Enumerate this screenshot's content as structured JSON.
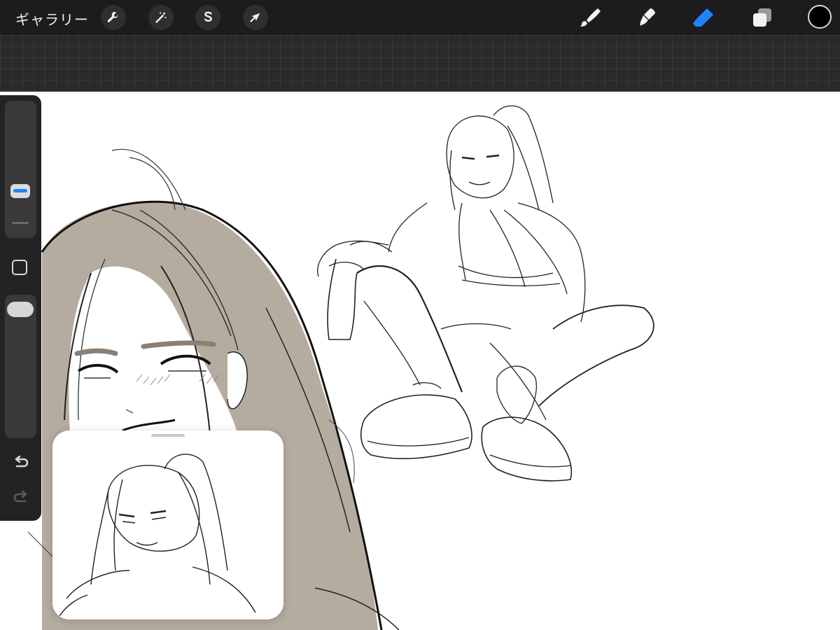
{
  "toolbar": {
    "gallery_label": "ギャラリー",
    "left_tools": [
      {
        "name": "actions",
        "icon": "wrench-icon"
      },
      {
        "name": "adjustments",
        "icon": "magic-wand-icon"
      },
      {
        "name": "selection",
        "icon": "selection-s-icon"
      },
      {
        "name": "transform",
        "icon": "arrow-cursor-icon"
      }
    ],
    "right_tools": [
      {
        "name": "brush",
        "icon": "brush-icon",
        "active": false
      },
      {
        "name": "smudge",
        "icon": "smudge-icon",
        "active": false
      },
      {
        "name": "eraser",
        "icon": "eraser-icon",
        "active": true
      },
      {
        "name": "layers",
        "icon": "layers-icon",
        "active": false
      }
    ],
    "current_color": "#000000"
  },
  "sidebar": {
    "brush_size_icon": "size-slider",
    "opacity_icon": "opacity-slider",
    "modify_icon": "square-icon",
    "undo_icon": "undo-icon",
    "redo_icon": "redo-icon"
  },
  "colors": {
    "accent": "#1e84ff",
    "toolbar_bg": "#1c1c1e",
    "hair_fill": "#b5aca0"
  },
  "reference_window": {
    "icon": "drag-handle-icon"
  }
}
